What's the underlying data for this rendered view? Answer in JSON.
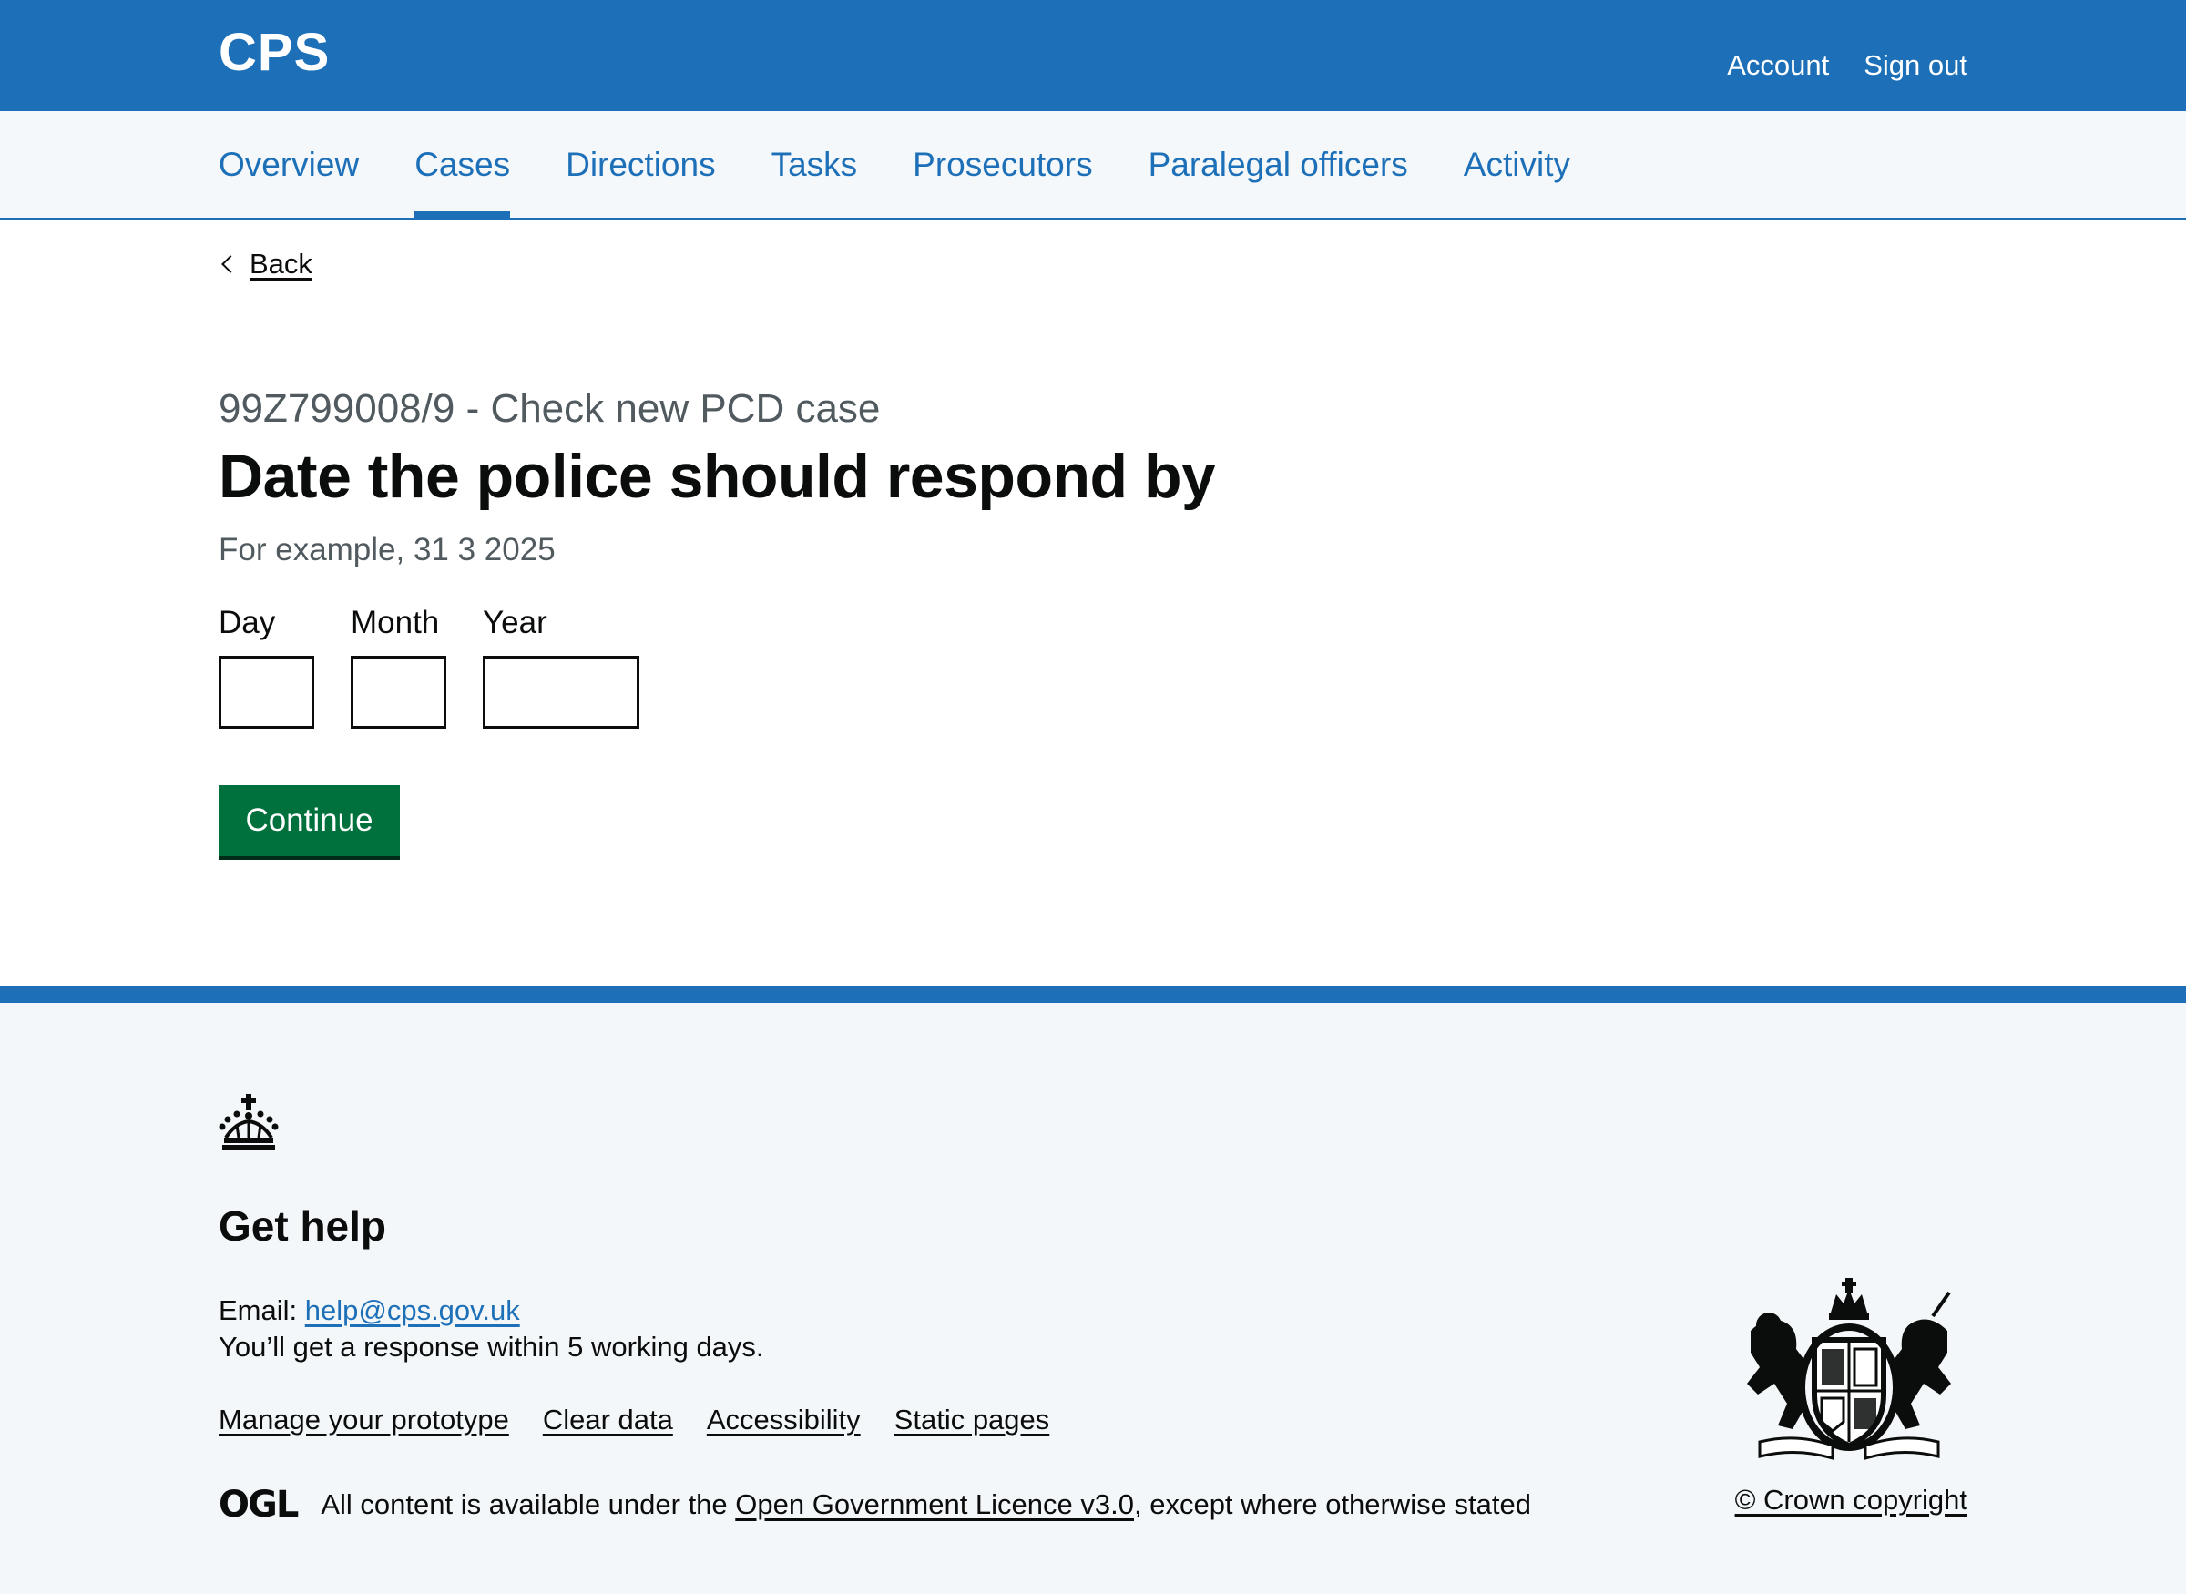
{
  "header": {
    "logo": "CPS",
    "account_label": "Account",
    "sign_out_label": "Sign out"
  },
  "nav": {
    "items": [
      {
        "label": "Overview"
      },
      {
        "label": "Cases",
        "active": true
      },
      {
        "label": "Directions"
      },
      {
        "label": "Tasks"
      },
      {
        "label": "Prosecutors"
      },
      {
        "label": "Paralegal officers"
      },
      {
        "label": "Activity"
      }
    ]
  },
  "back_label": "Back",
  "page": {
    "caption": "99Z799008/9 - Check new PCD case",
    "heading": "Date the police should respond by",
    "hint": "For example, 31 3 2025",
    "day_label": "Day",
    "month_label": "Month",
    "year_label": "Year",
    "day_value": "",
    "month_value": "",
    "year_value": "",
    "continue_label": "Continue"
  },
  "footer": {
    "heading": "Get help",
    "email_prefix": "Email: ",
    "email": "help@cps.gov.uk",
    "response_text": "You’ll get a response within 5 working days.",
    "links": [
      "Manage your prototype",
      "Clear data",
      "Accessibility",
      "Static pages"
    ],
    "ogl_logo": "OGL",
    "licence_prefix": "All content is available under the ",
    "licence_link": "Open Government Licence v3.0",
    "licence_suffix": ", except where otherwise stated",
    "copyright": "© Crown copyright"
  },
  "colors": {
    "brand_blue": "#1d70b8",
    "button_green": "#00703c",
    "text": "#0b0c0c",
    "secondary_text": "#505a5f",
    "footer_bg": "#f3f7fa"
  }
}
